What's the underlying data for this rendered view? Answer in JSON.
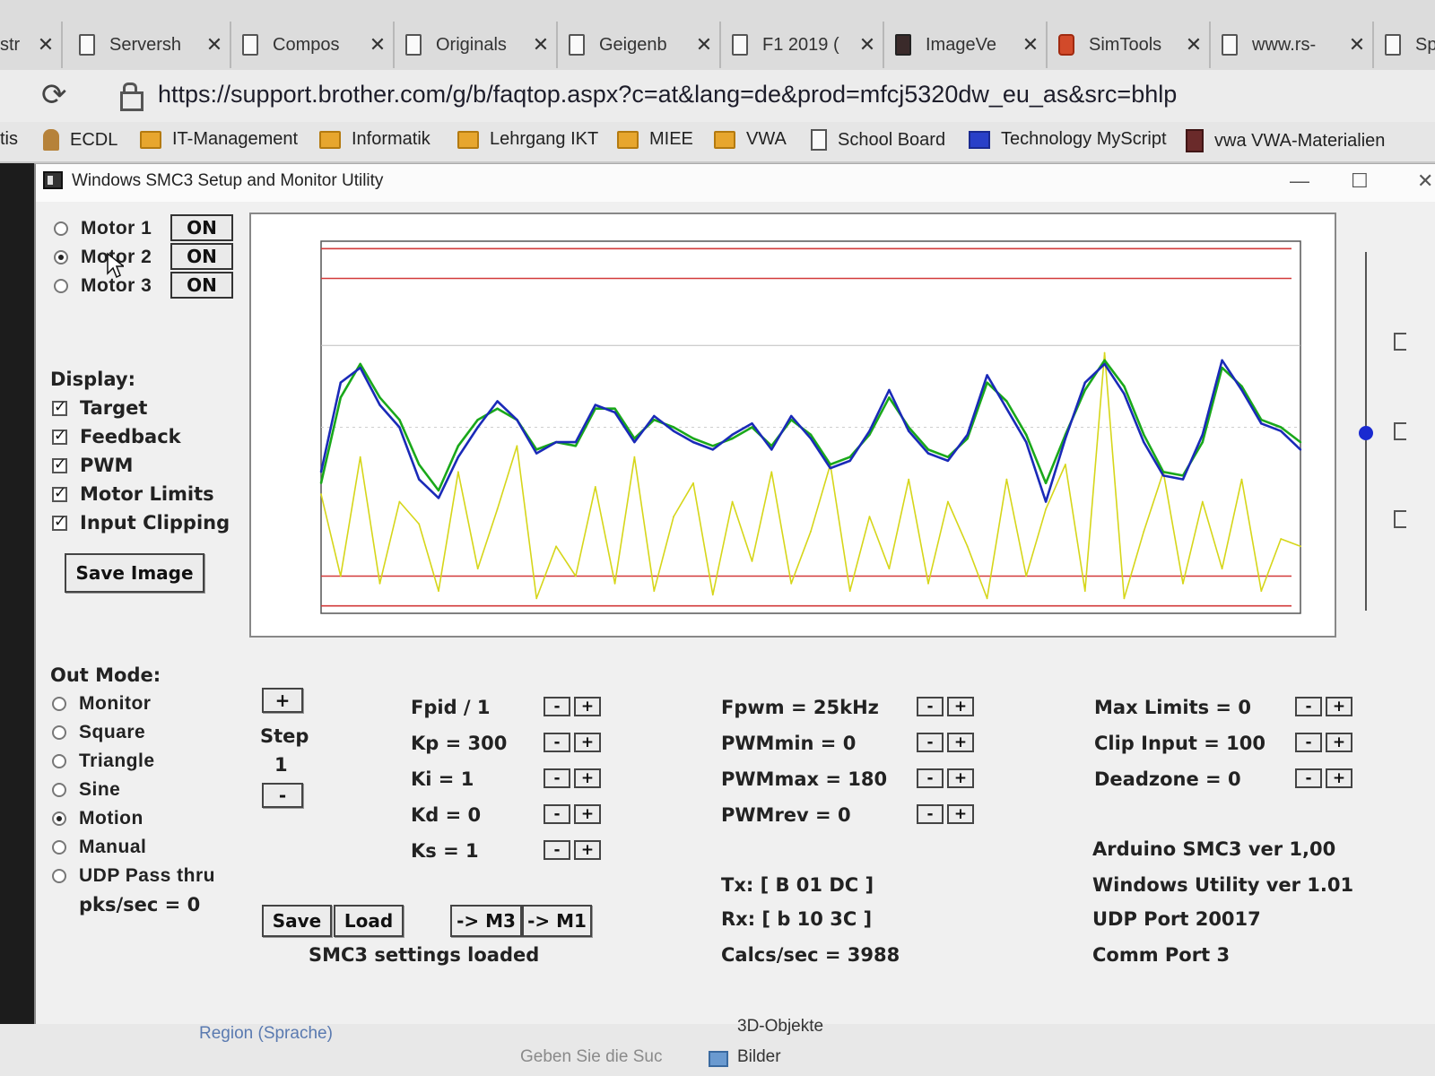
{
  "browser": {
    "tabs": [
      {
        "title": "str",
        "icon": "page-icon"
      },
      {
        "title": "Serversh",
        "icon": "page-icon"
      },
      {
        "title": "Compos",
        "icon": "page-icon"
      },
      {
        "title": "Originals",
        "icon": "page-icon"
      },
      {
        "title": "Geigenb",
        "icon": "page-icon"
      },
      {
        "title": "F1 2019 (",
        "icon": "page-icon"
      },
      {
        "title": "ImageVe",
        "icon": "image-icon"
      },
      {
        "title": "SimTools",
        "icon": "simtools-icon"
      },
      {
        "title": "www.rs-",
        "icon": "page-icon"
      },
      {
        "title": "Sp",
        "icon": "page-icon"
      }
    ],
    "close_glyph": "✕",
    "url": "https://support.brother.com/g/b/faqtop.aspx?c=at&lang=de&prod=mfcj5320dw_eu_as&src=bhlp",
    "bookmarks": [
      {
        "label": "tis",
        "icon": "none"
      },
      {
        "label": "ECDL",
        "icon": "person-icon"
      },
      {
        "label": "IT-Management",
        "icon": "folder-icon"
      },
      {
        "label": "Informatik",
        "icon": "folder-icon"
      },
      {
        "label": "Lehrgang IKT",
        "icon": "folder-icon"
      },
      {
        "label": "MIEE",
        "icon": "folder-icon"
      },
      {
        "label": "VWA",
        "icon": "folder-icon"
      },
      {
        "label": "School Board",
        "icon": "page-icon"
      },
      {
        "label": "Technology  MyScript",
        "icon": "myscript-icon"
      },
      {
        "label": "vwa VWA-Materialien",
        "icon": "bookmark-icon"
      }
    ]
  },
  "window": {
    "title": "Windows SMC3 Setup and Monitor Utility",
    "controls": {
      "minimize": "—",
      "maximize": "☐",
      "close": "✕"
    }
  },
  "motors": [
    {
      "label": "Motor 1",
      "selected": false,
      "state": "ON"
    },
    {
      "label": "Motor 2",
      "selected": true,
      "state": "ON"
    },
    {
      "label": "Motor 3",
      "selected": false,
      "state": "ON"
    }
  ],
  "display": {
    "heading": "Display:",
    "options": [
      {
        "label": "Target",
        "checked": true
      },
      {
        "label": "Feedback",
        "checked": true
      },
      {
        "label": "PWM",
        "checked": true
      },
      {
        "label": "Motor Limits",
        "checked": true
      },
      {
        "label": "Input Clipping",
        "checked": true
      }
    ],
    "save_image": "Save Image"
  },
  "out_mode": {
    "heading": "Out Mode:",
    "options": [
      {
        "label": "Monitor",
        "selected": false
      },
      {
        "label": "Square",
        "selected": false
      },
      {
        "label": "Triangle",
        "selected": false
      },
      {
        "label": "Sine",
        "selected": false
      },
      {
        "label": "Motion",
        "selected": true
      },
      {
        "label": "Manual",
        "selected": false
      },
      {
        "label": "UDP Pass thru",
        "selected": false
      }
    ],
    "pks": "pks/sec = 0"
  },
  "step": {
    "plus": "+",
    "label": "Step",
    "value": "1",
    "minus": "-"
  },
  "pid": [
    {
      "label": "Fpid / 1"
    },
    {
      "label": "Kp = 300"
    },
    {
      "label": "Ki = 1"
    },
    {
      "label": "Kd = 0"
    },
    {
      "label": "Ks = 1"
    }
  ],
  "pwm": [
    {
      "label": "Fpwm = 25kHz"
    },
    {
      "label": "PWMmin = 0"
    },
    {
      "label": "PWMmax = 180"
    },
    {
      "label": "PWMrev = 0"
    }
  ],
  "limits": [
    {
      "label": "Max Limits = 0"
    },
    {
      "label": "Clip Input = 100"
    },
    {
      "label": "Deadzone = 0"
    }
  ],
  "stepper": {
    "minus": "-",
    "plus": "+"
  },
  "actions": {
    "save": "Save",
    "load": "Load",
    "to_m3": "-> M3",
    "to_m1": "-> M1",
    "status": "SMC3 settings loaded"
  },
  "comm": {
    "tx": "Tx: [ B 01 DC ]",
    "rx": "Rx: [ b 10 3C ]",
    "calcs": "Calcs/sec = 3988"
  },
  "info": {
    "arduino": "Arduino SMC3 ver 1,00",
    "utility": "Windows Utility ver 1.01",
    "udp": "UDP Port 20017",
    "comm_port": "Comm Port 3"
  },
  "desktop_below": {
    "region": "Region (Sprache)",
    "search": "Geben Sie die Suc",
    "objects": "3D-Objekte",
    "pictures": "Bilder"
  },
  "colors": {
    "target": "#1aa81a",
    "feedback": "#1a2ab8",
    "pwm": "#d6d61a",
    "limits": "#d23a3a",
    "accent_slider": "#1a2ad0"
  },
  "chart_data": {
    "type": "line",
    "title": "",
    "ylim": [
      0,
      100
    ],
    "x": [
      0,
      2,
      4,
      6,
      8,
      10,
      12,
      14,
      16,
      18,
      20,
      22,
      24,
      26,
      28,
      30,
      32,
      34,
      36,
      38,
      40,
      42,
      44,
      46,
      48,
      50,
      52,
      54,
      56,
      58,
      60,
      62,
      64,
      66,
      68,
      70,
      72,
      74,
      76,
      78,
      80,
      82,
      84,
      86,
      88,
      90,
      92,
      94,
      96,
      98,
      100
    ],
    "series": [
      {
        "name": "Target",
        "color": "#1aa81a",
        "values": [
          35,
          58,
          67,
          58,
          52,
          40,
          33,
          45,
          52,
          55,
          52,
          44,
          46,
          45,
          55,
          55,
          47,
          52,
          50,
          47,
          45,
          47,
          50,
          45,
          52,
          48,
          40,
          42,
          48,
          58,
          50,
          44,
          42,
          47,
          62,
          57,
          48,
          35,
          48,
          60,
          68,
          61,
          48,
          38,
          37,
          46,
          66,
          61,
          52,
          50,
          46
        ]
      },
      {
        "name": "Feedback",
        "color": "#1a2ab8",
        "values": [
          38,
          62,
          66,
          56,
          50,
          36,
          31,
          42,
          50,
          57,
          52,
          43,
          46,
          46,
          56,
          54,
          46,
          53,
          49,
          46,
          44,
          48,
          51,
          44,
          53,
          47,
          39,
          41,
          49,
          60,
          49,
          43,
          41,
          48,
          64,
          55,
          46,
          30,
          47,
          62,
          67,
          59,
          46,
          37,
          36,
          48,
          68,
          60,
          51,
          49,
          44
        ]
      },
      {
        "name": "PWM",
        "color": "#d6d61a",
        "values": [
          32,
          10,
          42,
          8,
          30,
          24,
          6,
          38,
          12,
          28,
          45,
          4,
          18,
          10,
          34,
          8,
          42,
          6,
          26,
          35,
          5,
          30,
          14,
          38,
          8,
          22,
          40,
          6,
          26,
          12,
          36,
          8,
          30,
          18,
          4,
          36,
          10,
          28,
          40,
          6,
          70,
          4,
          22,
          38,
          8,
          30,
          12,
          36,
          6,
          20,
          18
        ]
      }
    ],
    "limit_lines": [
      {
        "name": "Motor Limits",
        "values": [
          98,
          2
        ]
      },
      {
        "name": "Input Clipping",
        "values": [
          90,
          10
        ]
      }
    ]
  }
}
